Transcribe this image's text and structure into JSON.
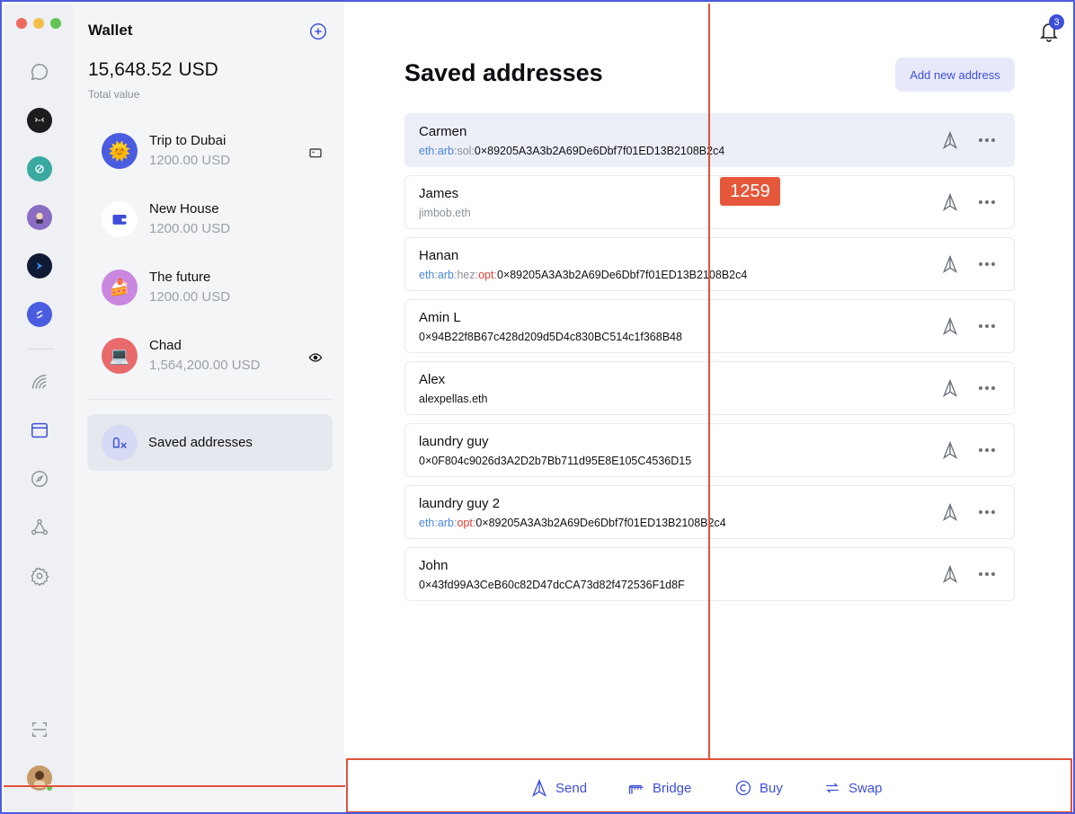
{
  "rail": {
    "traffic_colors": [
      "#ed6a5e",
      "#f4be4f",
      "#61c454"
    ],
    "apps": [
      {
        "icon": "chat-bubble-icon"
      },
      {
        "icon": "app-dark-icon",
        "color": "#1c1c1e"
      },
      {
        "icon": "app-teal-icon",
        "color": "#3aa9a0"
      },
      {
        "icon": "app-avatar-icon",
        "color": "#8a6cc4"
      },
      {
        "icon": "app-navy-icon",
        "color": "#111a33"
      },
      {
        "icon": "app-blue-icon",
        "color": "#4a5ce0"
      }
    ],
    "tools": [
      "rainbow-icon",
      "browser-window-icon",
      "compass-icon",
      "network-icon",
      "gear-icon"
    ],
    "scan_icon": "scan-icon",
    "profile_icon": "profile-avatar-icon"
  },
  "sidebar": {
    "title": "Wallet",
    "total_amount": "15,648.52",
    "total_currency": "USD",
    "total_label": "Total value",
    "accounts": [
      {
        "name": "Trip to Dubai",
        "value": "1200.00 USD",
        "avatar": "🌞",
        "avatar_color": "#4a5ce0",
        "trailing_icon": "card-icon"
      },
      {
        "name": "New House",
        "value": "1200.00 USD",
        "avatar": "wallet",
        "avatar_color": "#ffffff",
        "trailing_icon": ""
      },
      {
        "name": "The future",
        "value": "1200.00 USD",
        "avatar": "🍰",
        "avatar_color": "#c987e0",
        "trailing_icon": ""
      },
      {
        "name": "Chad",
        "value": "1,564,200.00 USD",
        "avatar": "💻",
        "avatar_color": "#e86a6a",
        "trailing_icon": "eye-icon"
      }
    ],
    "saved_label": "Saved addresses"
  },
  "main": {
    "notification_count": "3",
    "title": "Saved addresses",
    "add_button": "Add new address",
    "addresses": [
      {
        "name": "Carmen",
        "selected": true,
        "prefixes": [
          "eth",
          "arb",
          "sol"
        ],
        "address": "0×89205A3A3b2A69De6Dbf7f01ED13B2108B2c4"
      },
      {
        "name": "James",
        "selected": false,
        "prefixes": [],
        "address": "jimbob.eth",
        "muted": true
      },
      {
        "name": "Hanan",
        "selected": false,
        "prefixes": [
          "eth",
          "arb",
          "hez",
          "opt"
        ],
        "address": "0×89205A3A3b2A69De6Dbf7f01ED13B2108B2c4"
      },
      {
        "name": "Amin L",
        "selected": false,
        "prefixes": [],
        "address": "0×94B22f8B67c428d209d5D4c830BC514c1f368B48"
      },
      {
        "name": "Alex",
        "selected": false,
        "prefixes": [],
        "address": "alexpellas.eth"
      },
      {
        "name": "laundry guy",
        "selected": false,
        "prefixes": [],
        "address": "0×0F804c9026d3A2D2b7Bb711d95E8E105C4536D15"
      },
      {
        "name": "laundry guy 2",
        "selected": false,
        "prefixes": [
          "eth",
          "arb",
          "opt"
        ],
        "address": "0×89205A3A3b2A69De6Dbf7f01ED13B2108B2c4"
      },
      {
        "name": "John",
        "selected": false,
        "prefixes": [],
        "address": "0×43fd99A3CeB60c82D47dcCA73d82f472536F1d8F"
      }
    ]
  },
  "actions": [
    {
      "label": "Send",
      "icon": "send-icon"
    },
    {
      "label": "Bridge",
      "icon": "bridge-icon"
    },
    {
      "label": "Buy",
      "icon": "buy-icon"
    },
    {
      "label": "Swap",
      "icon": "swap-icon"
    }
  ],
  "overlay": {
    "badge_number": "1259"
  },
  "colors": {
    "accent": "#3d4fd8",
    "overlay_red": "#e0523a",
    "frame_blue": "#4d5bdc"
  }
}
